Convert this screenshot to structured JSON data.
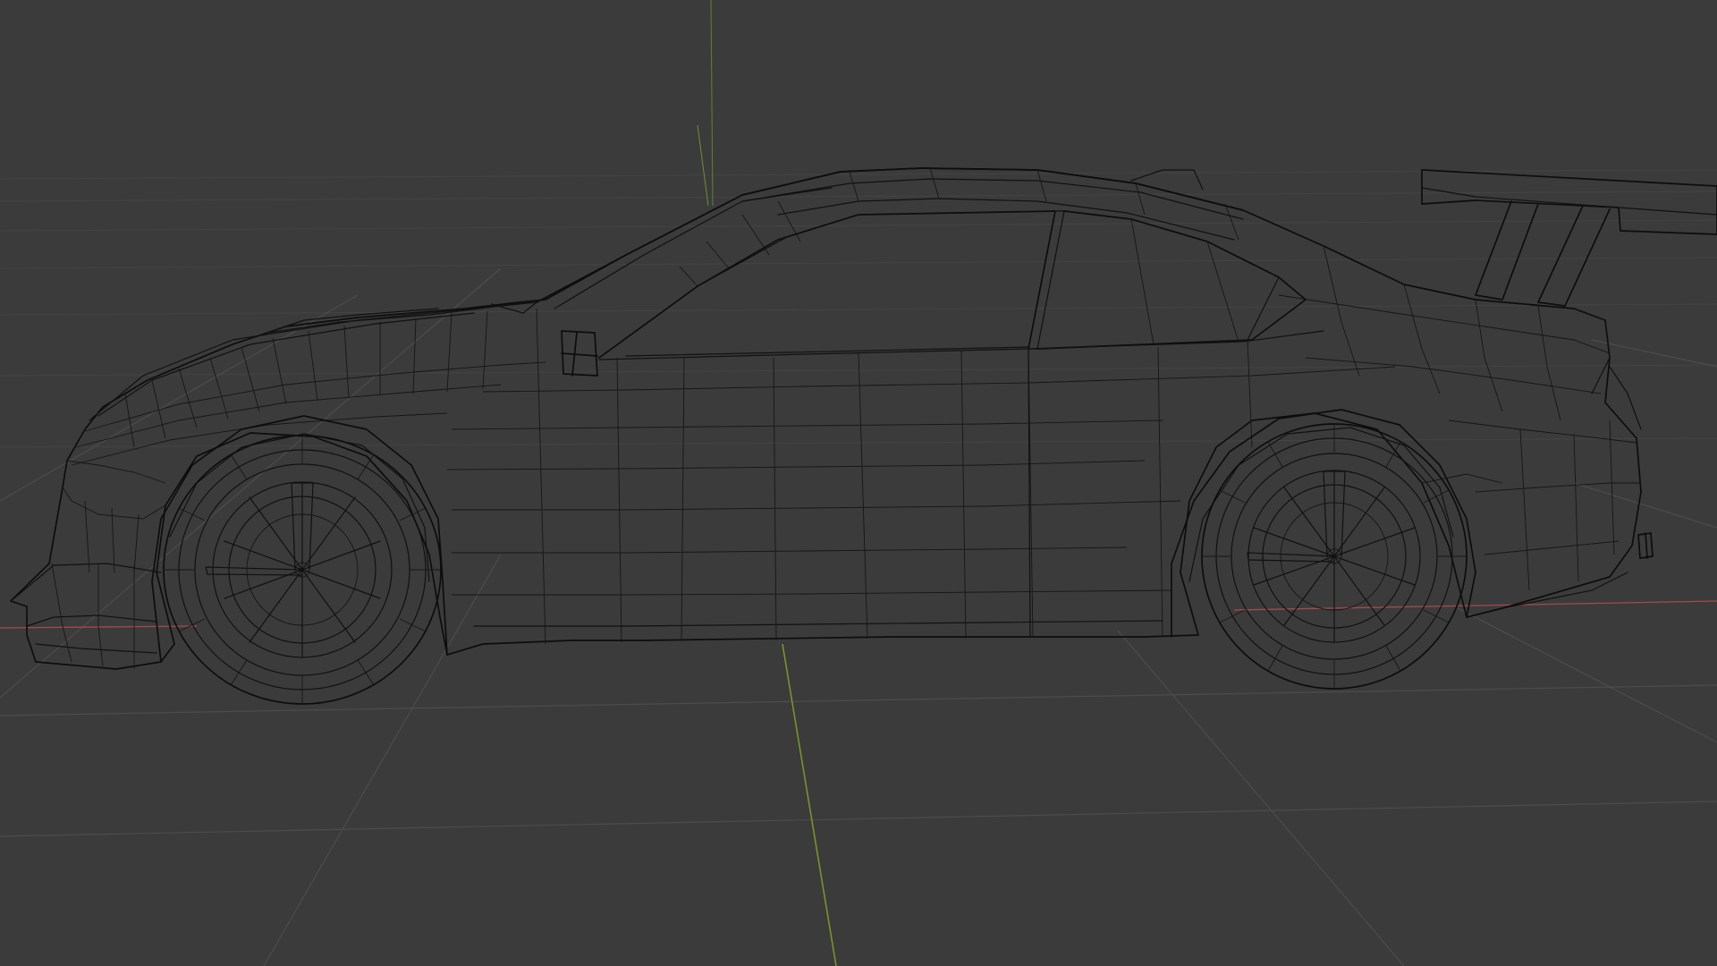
{
  "viewport": {
    "mode": "wireframe",
    "background_color": "#3b3b3b",
    "grid_color": "#4c4c4c",
    "axis_colors": {
      "x_axis": "#a44a4a",
      "y_axis": "#7a9a2e",
      "z_axis": "#6a8a38"
    },
    "wire_color": "#111111"
  },
  "model": {
    "object": "car-wireframe-mesh",
    "parts": [
      "body",
      "front-wheel",
      "rear-wheel",
      "rear-wing",
      "side-mirror",
      "exhaust"
    ]
  }
}
